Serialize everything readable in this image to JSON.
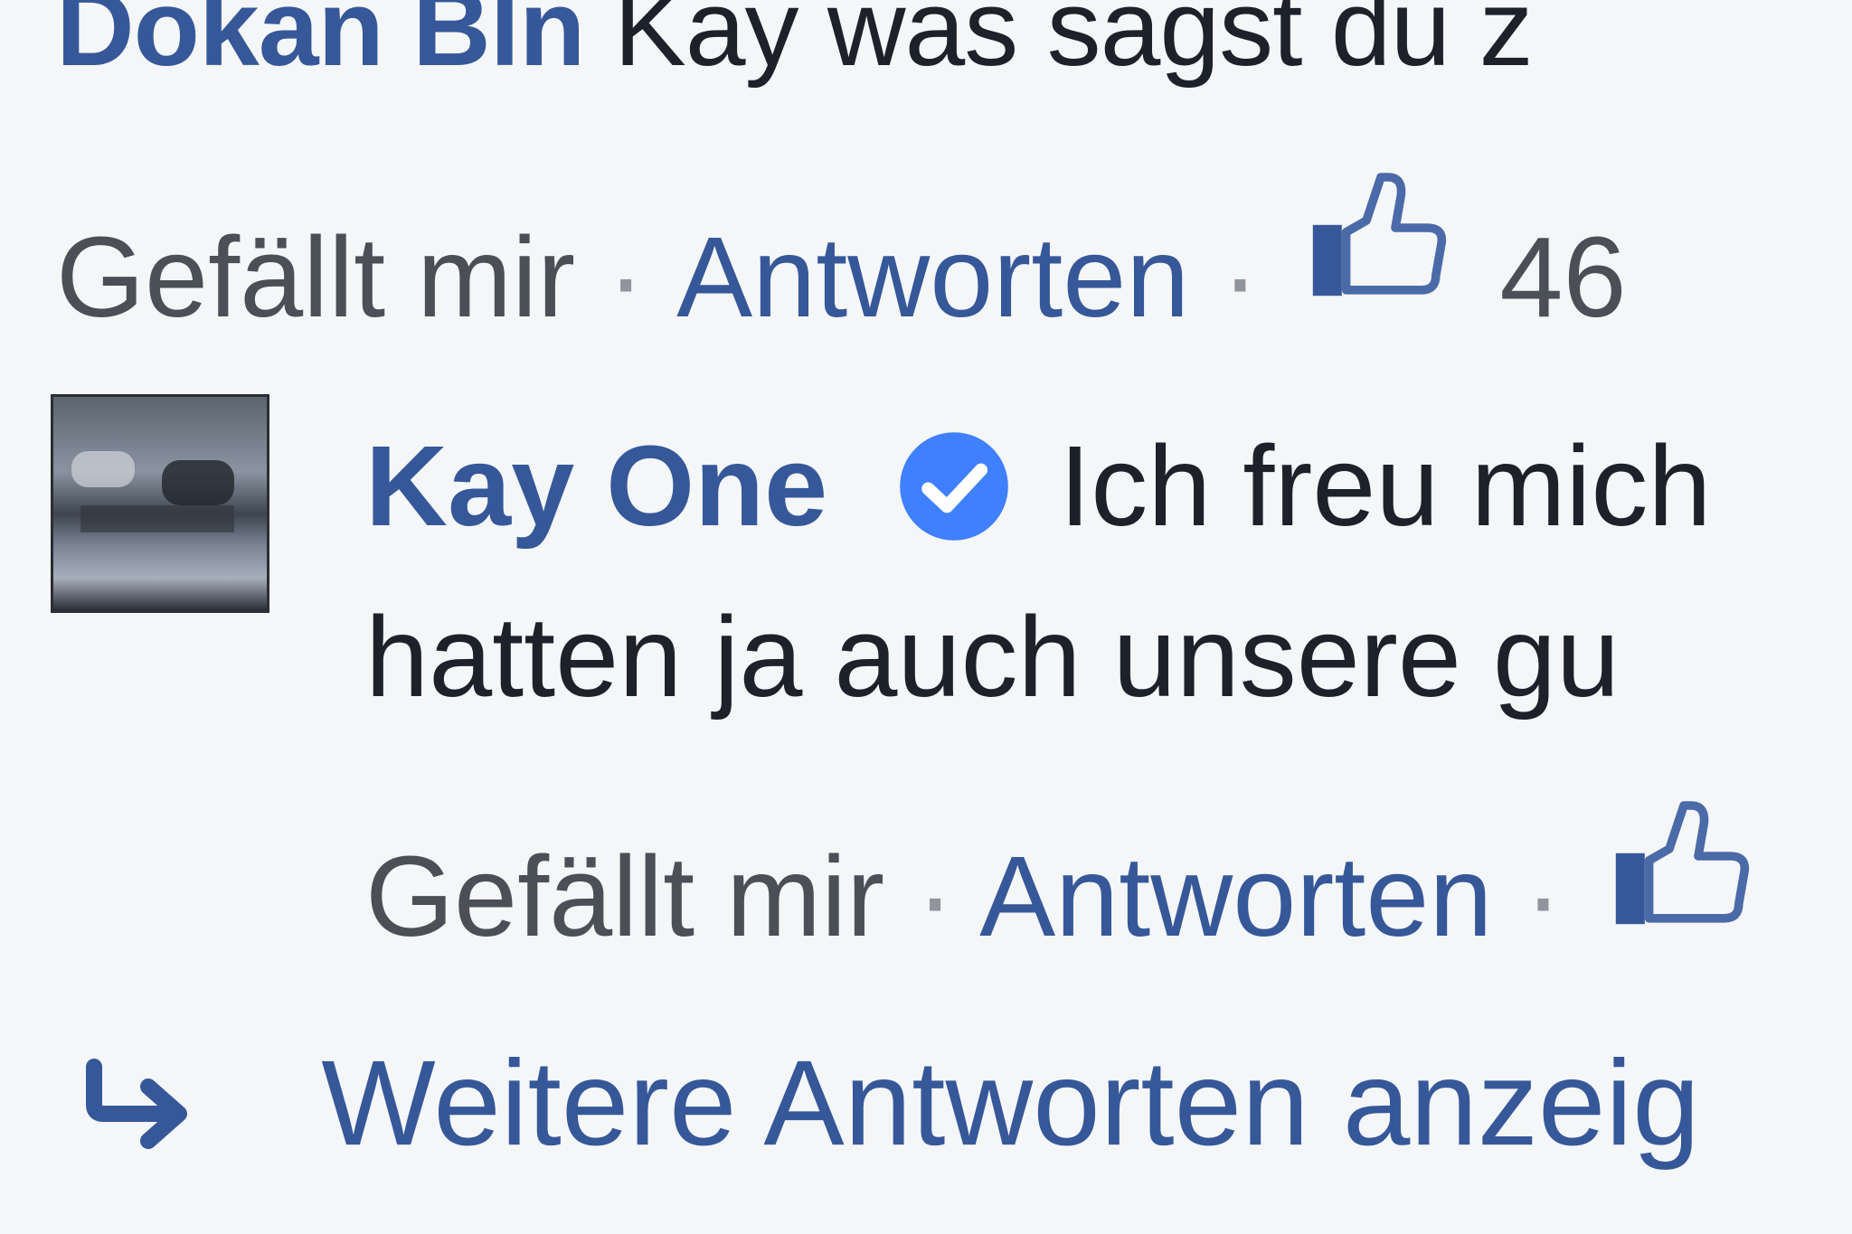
{
  "comment": {
    "author": "Dokan Bln",
    "text": "Kay was sagst du z",
    "actions": {
      "like_label": "Gefällt mir",
      "reply_label": "Antworten",
      "separator": "·",
      "like_count": "46"
    }
  },
  "reply": {
    "author": "Kay One",
    "text_line1": "Ich freu mich",
    "text_line2": "hatten ja auch unsere gu",
    "actions": {
      "like_label": "Gefällt mir",
      "reply_label": "Antworten",
      "separator": "·"
    }
  },
  "more_replies": {
    "label": "Weitere Antworten anzeig"
  },
  "colors": {
    "link": "#365899",
    "text": "#1d2129",
    "verified": "#4080ff",
    "background": "#f5f6f8"
  },
  "icons": {
    "like": "thumbs-up-icon",
    "verified": "verified-badge-icon",
    "reply_arrow": "reply-arrow-icon"
  }
}
